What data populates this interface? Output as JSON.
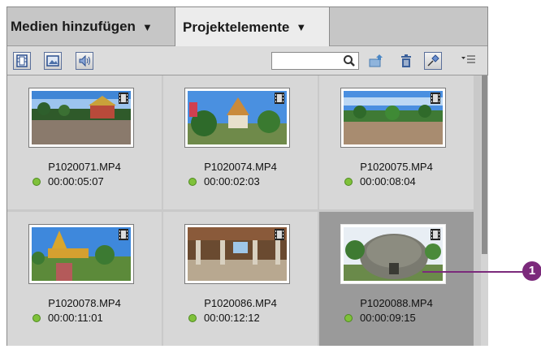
{
  "tabs": [
    {
      "label": "Medien hinzufügen",
      "caret": "▼"
    },
    {
      "label": "Projektelemente",
      "caret": "▼"
    }
  ],
  "toolbar": {
    "search": {
      "value": "",
      "placeholder": ""
    },
    "icons": [
      "video-filter-icon",
      "image-filter-icon",
      "audio-filter-icon",
      "search-icon",
      "folder-up-icon",
      "trash-icon",
      "pin-icon",
      "panel-menu-icon"
    ]
  },
  "clips": [
    {
      "name": "P1020071.MP4",
      "duration": "00:00:05:07"
    },
    {
      "name": "P1020074.MP4",
      "duration": "00:00:02:03"
    },
    {
      "name": "P1020075.MP4",
      "duration": "00:00:08:04"
    },
    {
      "name": "P1020078.MP4",
      "duration": "00:00:11:01"
    },
    {
      "name": "P1020086.MP4",
      "duration": "00:00:12:12"
    },
    {
      "name": "P1020088.MP4",
      "duration": "00:00:09:15",
      "selected": true
    }
  ],
  "callout": {
    "number": "1"
  },
  "colors": {
    "accent": "#7b2a7b",
    "status_ok": "#7fc13a",
    "selected": "#9a9a9a"
  }
}
